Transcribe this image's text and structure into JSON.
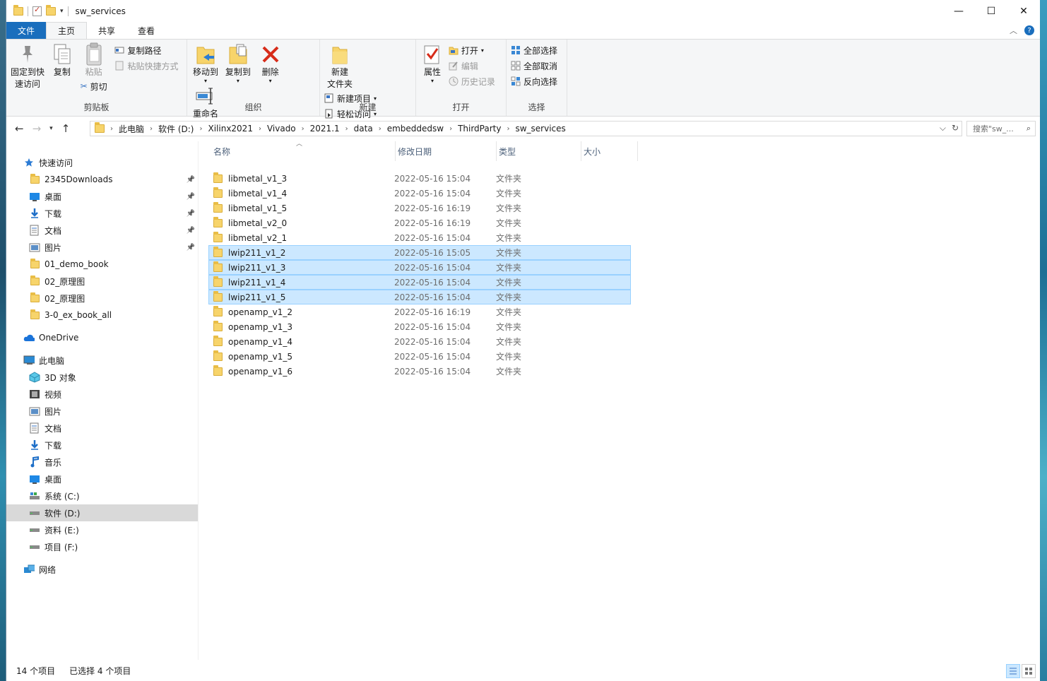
{
  "window": {
    "title": "sw_services",
    "controls": {
      "minimize": "—",
      "maximize": "☐",
      "close": "✕"
    }
  },
  "ribbon_tabs": [
    "文件",
    "主页",
    "共享",
    "查看"
  ],
  "ribbon": {
    "clipboard": {
      "label": "剪贴板",
      "pin_label": "固定到快\n速访问",
      "copy_label": "复制",
      "paste_label": "粘贴",
      "copy_path": "复制路径",
      "paste_shortcut": "粘贴快捷方式",
      "cut": "剪切"
    },
    "organize": {
      "label": "组织",
      "move_to": "移动到",
      "copy_to": "复制到",
      "delete": "删除",
      "rename": "重命名"
    },
    "new": {
      "label": "新建",
      "new_folder": "新建\n文件夹",
      "new_item": "新建项目",
      "easy_access": "轻松访问"
    },
    "open": {
      "label": "打开",
      "properties": "属性",
      "open": "打开",
      "edit": "编辑",
      "history": "历史记录"
    },
    "select": {
      "label": "选择",
      "select_all": "全部选择",
      "select_none": "全部取消",
      "invert": "反向选择"
    }
  },
  "address": {
    "crumbs": [
      "此电脑",
      "软件 (D:)",
      "Xilinx2021",
      "Vivado",
      "2021.1",
      "data",
      "embeddedsw",
      "ThirdParty",
      "sw_services"
    ],
    "search_placeholder": "搜索\"sw_..."
  },
  "sidebar": {
    "quick_access": "快速访问",
    "quick_items": [
      {
        "label": "2345Downloads",
        "icon": "folder",
        "pinned": true
      },
      {
        "label": "桌面",
        "icon": "desktop",
        "pinned": true
      },
      {
        "label": "下载",
        "icon": "download",
        "pinned": true
      },
      {
        "label": "文档",
        "icon": "document",
        "pinned": true
      },
      {
        "label": "图片",
        "icon": "picture",
        "pinned": true
      },
      {
        "label": "01_demo_book",
        "icon": "folder",
        "pinned": false
      },
      {
        "label": "02_原理图",
        "icon": "folder",
        "pinned": false
      },
      {
        "label": "02_原理图",
        "icon": "folder",
        "pinned": false
      },
      {
        "label": "3-0_ex_book_all",
        "icon": "folder",
        "pinned": false
      }
    ],
    "onedrive": "OneDrive",
    "this_pc": "此电脑",
    "pc_items": [
      {
        "label": "3D 对象",
        "icon": "3d"
      },
      {
        "label": "视频",
        "icon": "video"
      },
      {
        "label": "图片",
        "icon": "picture"
      },
      {
        "label": "文档",
        "icon": "document"
      },
      {
        "label": "下载",
        "icon": "download"
      },
      {
        "label": "音乐",
        "icon": "music"
      },
      {
        "label": "桌面",
        "icon": "desktop"
      },
      {
        "label": "系统 (C:)",
        "icon": "drive-system"
      },
      {
        "label": "软件 (D:)",
        "icon": "drive",
        "selected": true
      },
      {
        "label": "资料 (E:)",
        "icon": "drive"
      },
      {
        "label": "项目 (F:)",
        "icon": "drive"
      }
    ],
    "network": "网络"
  },
  "columns": {
    "name": "名称",
    "date": "修改日期",
    "type": "类型",
    "size": "大小"
  },
  "files": [
    {
      "name": "libmetal_v1_3",
      "date": "2022-05-16 15:04",
      "type": "文件夹",
      "selected": false
    },
    {
      "name": "libmetal_v1_4",
      "date": "2022-05-16 15:04",
      "type": "文件夹",
      "selected": false
    },
    {
      "name": "libmetal_v1_5",
      "date": "2022-05-16 16:19",
      "type": "文件夹",
      "selected": false
    },
    {
      "name": "libmetal_v2_0",
      "date": "2022-05-16 16:19",
      "type": "文件夹",
      "selected": false
    },
    {
      "name": "libmetal_v2_1",
      "date": "2022-05-16 15:04",
      "type": "文件夹",
      "selected": false
    },
    {
      "name": "lwip211_v1_2",
      "date": "2022-05-16 15:05",
      "type": "文件夹",
      "selected": true
    },
    {
      "name": "lwip211_v1_3",
      "date": "2022-05-16 15:04",
      "type": "文件夹",
      "selected": true
    },
    {
      "name": "lwip211_v1_4",
      "date": "2022-05-16 15:04",
      "type": "文件夹",
      "selected": true
    },
    {
      "name": "lwip211_v1_5",
      "date": "2022-05-16 15:04",
      "type": "文件夹",
      "selected": true
    },
    {
      "name": "openamp_v1_2",
      "date": "2022-05-16 16:19",
      "type": "文件夹",
      "selected": false
    },
    {
      "name": "openamp_v1_3",
      "date": "2022-05-16 15:04",
      "type": "文件夹",
      "selected": false
    },
    {
      "name": "openamp_v1_4",
      "date": "2022-05-16 15:04",
      "type": "文件夹",
      "selected": false
    },
    {
      "name": "openamp_v1_5",
      "date": "2022-05-16 15:04",
      "type": "文件夹",
      "selected": false
    },
    {
      "name": "openamp_v1_6",
      "date": "2022-05-16 15:04",
      "type": "文件夹",
      "selected": false
    }
  ],
  "status": {
    "count": "14 个项目",
    "selected": "已选择 4 个项目"
  },
  "colors": {
    "accent": "#1a6ebd",
    "selection": "#cce8ff",
    "selection_border": "#99d1ff",
    "folder": "#f7d46b"
  }
}
